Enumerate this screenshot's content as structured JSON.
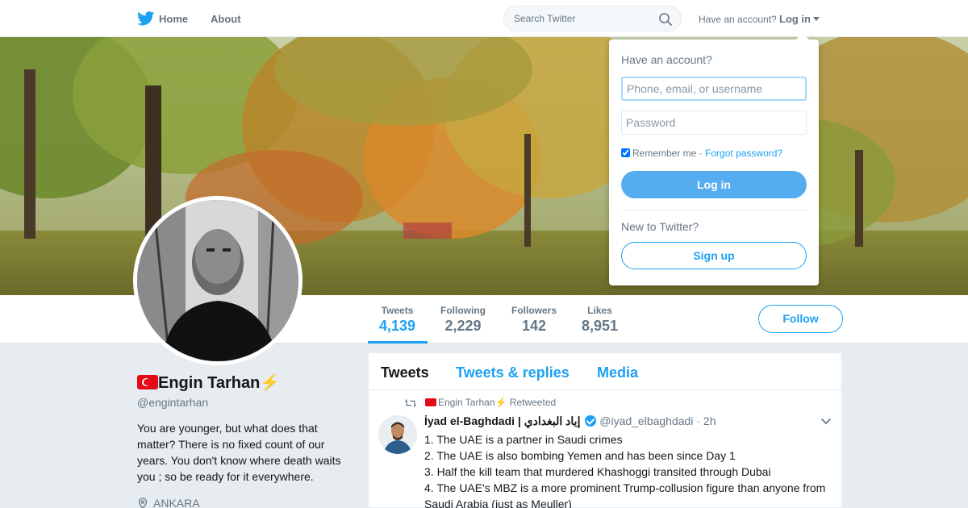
{
  "nav": {
    "home_label": "Home",
    "about_label": "About",
    "search_placeholder": "Search Twitter",
    "have_account_text": "Have an account?",
    "login_label": "Log in"
  },
  "profile": {
    "display_name": "Engin Tarhan",
    "name_emoji": "⚡",
    "handle": "@engintarhan",
    "bio": "You are younger, but what does that matter? There is no fixed count of our years. You don't know where death waits you ; so be ready for it everywhere.",
    "location": "ANKARA"
  },
  "stats": [
    {
      "label": "Tweets",
      "value": "4,139",
      "active": true
    },
    {
      "label": "Following",
      "value": "2,229",
      "active": false
    },
    {
      "label": "Followers",
      "value": "142",
      "active": false
    },
    {
      "label": "Likes",
      "value": "8,951",
      "active": false
    }
  ],
  "follow_label": "Follow",
  "timeline": {
    "tabs": [
      "Tweets",
      "Tweets & replies",
      "Media"
    ],
    "tweet": {
      "retweeter": "Engin Tarhan",
      "retweeter_emoji": "⚡",
      "retweeted_label": "Retweeted",
      "author_name": "İyad el-Baghdadi | إياد البغدادي",
      "author_handle": "@iyad_elbaghdadi",
      "separator": "·",
      "time": "2h",
      "lines": [
        "1. The UAE is a partner in Saudi crimes",
        "2. The UAE is also bombing Yemen and has been since Day 1",
        "3. Half the kill team that murdered Khashoggi transited through Dubai",
        "4. The UAE's MBZ is a more prominent Trump-collusion figure than anyone from Saudi Arabia (just as Meuller)"
      ]
    }
  },
  "login_dropdown": {
    "title": "Have an account?",
    "username_placeholder": "Phone, email, or username",
    "password_placeholder": "Password",
    "remember_label": "Remember me",
    "separator": "·",
    "forgot_label": "Forgot password?",
    "login_button": "Log in",
    "new_label": "New to Twitter?",
    "signup_button": "Sign up"
  },
  "icons": {
    "brand": "twitter-bird-icon",
    "search": "search-icon",
    "retweet": "retweet-icon",
    "verified": "verified-badge-icon",
    "location": "location-pin-icon",
    "tweet_menu": "chevron-down-icon"
  },
  "colors": {
    "accent": "#1da1f2",
    "login_button": "#55acee",
    "muted": "#657786",
    "background": "#e6ecf0",
    "flag_red": "#e30a17",
    "bolt": "#f5a623"
  }
}
